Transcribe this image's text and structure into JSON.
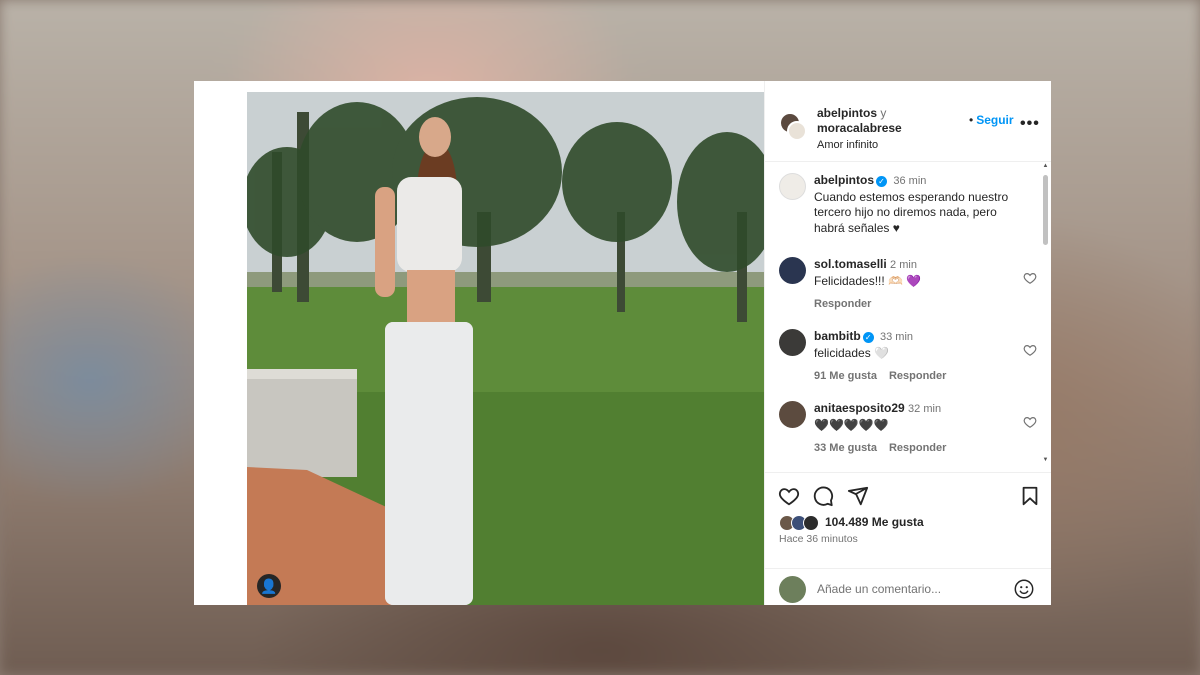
{
  "header": {
    "user1": "abelpintos",
    "conjunction": "y",
    "user2": "moracalabrese",
    "audio": "Amor infinito",
    "follow_label": "Seguir",
    "more_icon": "more-icon"
  },
  "caption": {
    "user": "abelpintos",
    "time": "36 min",
    "text": "Cuando estemos esperando nuestro tercero hijo no diremos nada, pero habrá señales ♥"
  },
  "comments": [
    {
      "user": "sol.tomaselli",
      "time": "2 min",
      "text": "Felicidades!!! 🫶🏻 💜",
      "likes": "",
      "reply": "Responder"
    },
    {
      "user": "bambitb",
      "time": "33 min",
      "text": "felicidades 🤍",
      "likes": "91 Me gusta",
      "reply": "Responder"
    },
    {
      "user": "anitaesposito29",
      "time": "32 min",
      "text": "🖤🖤🖤🖤🖤",
      "likes": "33 Me gusta",
      "reply": "Responder"
    }
  ],
  "actions": {
    "likes": "104.489 Me gusta",
    "time_ago": "Hace 36 minutos"
  },
  "comment_box": {
    "placeholder": "Añade un comentario..."
  },
  "colors": {
    "link_blue": "#0095f6",
    "muted": "#737373",
    "text": "#262626"
  }
}
